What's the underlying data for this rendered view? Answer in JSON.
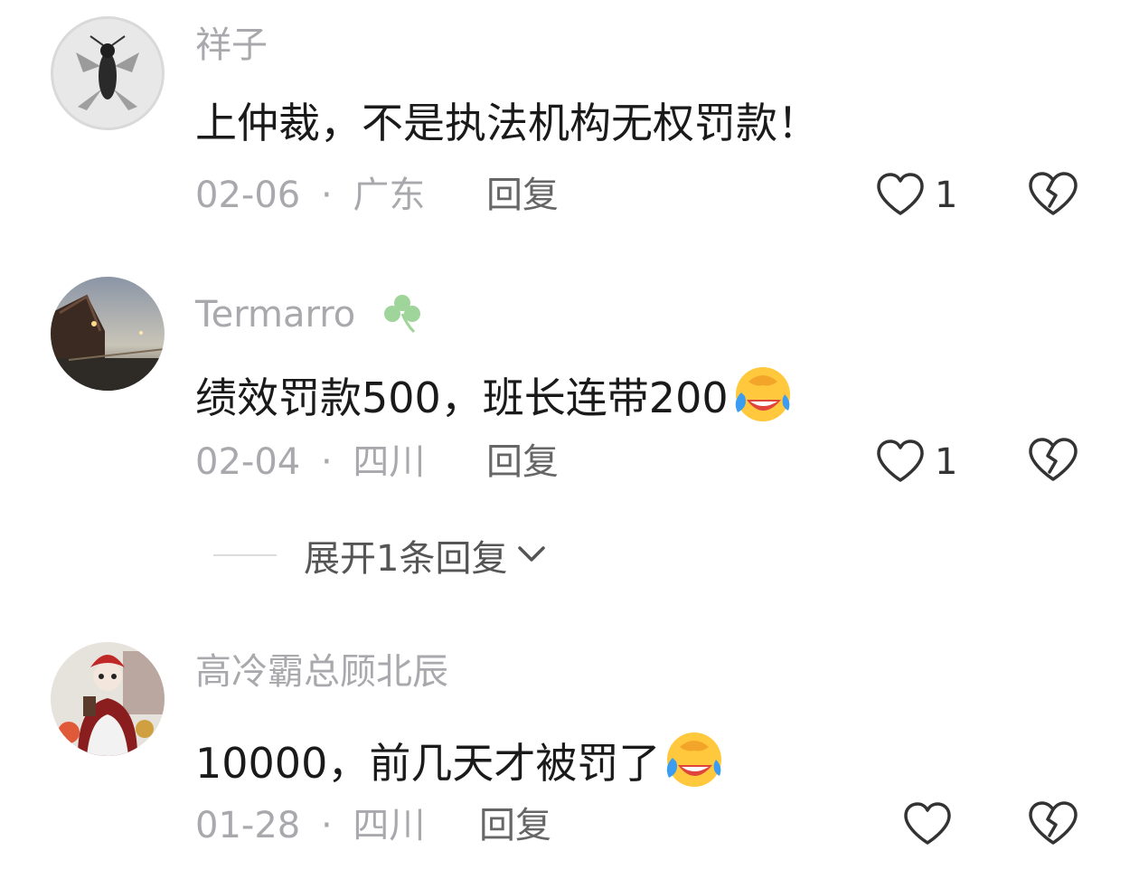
{
  "comments": [
    {
      "username": "祥子",
      "content": "上仲裁，不是执法机构无权罚款！",
      "date": "02-06",
      "separator": "·",
      "location": "广东",
      "reply_label": "回复",
      "like_count": "1"
    },
    {
      "username": "Termarro",
      "content": "绩效罚款500，班长连带200",
      "date": "02-04",
      "separator": "·",
      "location": "四川",
      "reply_label": "回复",
      "like_count": "1",
      "expand_label": "展开1条回复"
    },
    {
      "username": "高冷霸总顾北辰",
      "content": "10000，前几天才被罚了",
      "date": "01-28",
      "separator": "·",
      "location": "四川",
      "reply_label": "回复",
      "like_count": ""
    }
  ],
  "colors": {
    "username": "#a9a9ad",
    "content": "#1a1a1a",
    "meta": "#a9a9ad",
    "reply": "#666666",
    "clover": "#9fd49a",
    "emoji_face": "#ffc83d",
    "emoji_tear": "#3c9cf0"
  },
  "icons": {
    "badge": "clover-icon",
    "emoji": "laughing-crying-emoji",
    "like": "heart-outline-icon",
    "dislike": "broken-heart-icon",
    "expand": "chevron-down-icon"
  }
}
